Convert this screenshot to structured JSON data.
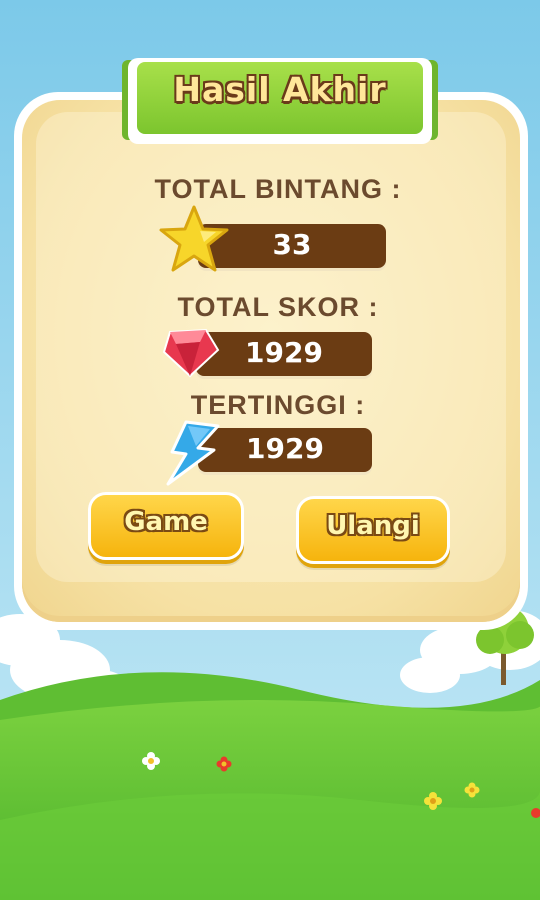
{
  "header": {
    "title": "Hasil Akhir"
  },
  "stats": [
    {
      "label": "TOTAL BINTANG :",
      "value": "33",
      "icon": "star-icon"
    },
    {
      "label": "TOTAL SKOR :",
      "value": "1929",
      "icon": "gem-icon"
    },
    {
      "label": "TERTINGGI :",
      "value": "1929",
      "icon": "lightning-icon"
    }
  ],
  "buttons": {
    "game_label": "Game",
    "retry_label": "Ulangi"
  },
  "colors": {
    "sky": "#8fd3ec",
    "grass": "#5cc235",
    "panel": "#f6e1a4",
    "ribbon": "#7cc52e",
    "button": "#f6b40d",
    "bar": "#6b3c13"
  }
}
